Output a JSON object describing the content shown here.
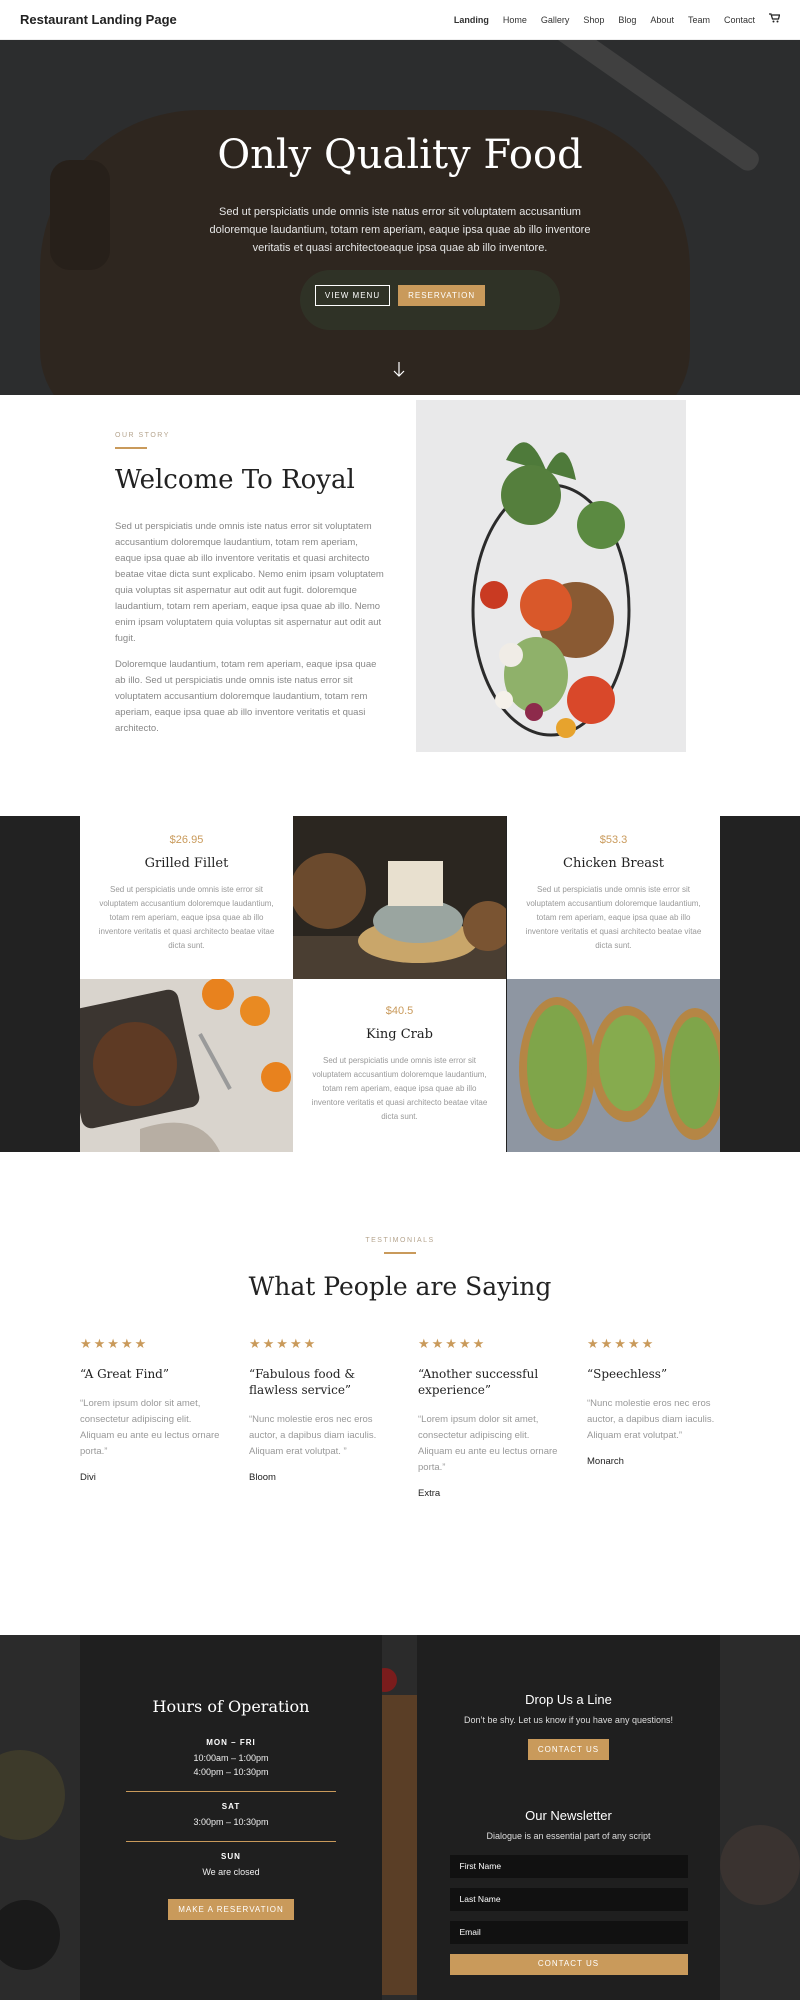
{
  "header": {
    "brand": "Restaurant Landing Page",
    "nav": [
      "Landing",
      "Home",
      "Gallery",
      "Shop",
      "Blog",
      "About",
      "Team",
      "Contact"
    ],
    "cart_icon": "cart-icon"
  },
  "hero": {
    "title": "Only Quality Food",
    "text": "Sed ut perspiciatis unde omnis iste natus error sit voluptatem accusantium doloremque laudantium, totam rem aperiam, eaque ipsa quae ab illo inventore veritatis et quasi architectoeaque ipsa quae ab illo inventore.",
    "btn_menu": "VIEW MENU",
    "btn_reservation": "RESERVATION",
    "arrow_icon": "arrow-down-icon"
  },
  "story": {
    "label": "OUR STORY",
    "title": "Welcome To Royal",
    "p1": "Sed ut perspiciatis unde omnis iste natus error sit voluptatem accusantium doloremque laudantium, totam rem aperiam, eaque ipsa quae ab illo inventore veritatis et quasi architecto beatae vitae dicta sunt explicabo. Nemo enim ipsam voluptatem quia voluptas sit aspernatur aut odit aut fugit. doloremque laudantium, totam rem aperiam, eaque ipsa quae ab illo. Nemo enim ipsam voluptatem quia voluptas sit aspernatur aut odit aut fugit.",
    "p2": "Doloremque laudantium, totam rem aperiam, eaque ipsa quae ab illo. Sed ut perspiciatis unde omnis iste natus error sit voluptatem accusantium doloremque laudantium, totam rem aperiam, eaque ipsa quae ab illo inventore veritatis et quasi architecto."
  },
  "menu": {
    "items": [
      {
        "price": "$26.95",
        "name": "Grilled Fillet",
        "desc": "Sed ut perspiciatis unde omnis iste error sit voluptatem accusantium doloremque laudantium, totam rem aperiam, eaque ipsa quae ab illo inventore veritatis et quasi architecto beatae vitae dicta sunt."
      },
      {
        "price": "$53.3",
        "name": "Chicken Breast",
        "desc": "Sed ut perspiciatis unde omnis iste error sit voluptatem accusantium doloremque laudantium, totam rem aperiam, eaque ipsa quae ab illo inventore veritatis et quasi architecto beatae vitae dicta sunt."
      },
      {
        "price": "$40.5",
        "name": "King Crab",
        "desc": "Sed ut perspiciatis unde omnis iste error sit voluptatem accusantium doloremque laudantium, totam rem aperiam, eaque ipsa quae ab illo inventore veritatis et quasi architecto beatae vitae dicta sunt."
      }
    ]
  },
  "testimonials": {
    "label": "TESTIMONIALS",
    "title": "What People are Saying",
    "stars": "★★★★★",
    "items": [
      {
        "head": "“A Great Find”",
        "body": "“Lorem ipsum dolor sit amet, consectetur adipiscing elit. Aliquam eu ante eu lectus ornare porta.”",
        "author": "Divi"
      },
      {
        "head": "“Fabulous food & flawless service”",
        "body": "“Nunc molestie eros nec eros auctor, a dapibus diam iaculis. Aliquam erat volutpat. ”",
        "author": "Bloom"
      },
      {
        "head": "“Another successful experience”",
        "body": "“Lorem ipsum dolor sit amet, consectetur adipiscing elit. Aliquam eu ante eu lectus ornare porta.”",
        "author": "Extra"
      },
      {
        "head": "“Speechless”",
        "body": "“Nunc molestie eros nec eros auctor, a dapibus diam iaculis. Aliquam erat volutpat.”",
        "author": "Monarch"
      }
    ]
  },
  "hours": {
    "title": "Hours of Operation",
    "mon_fri_label": "MON – FRI",
    "mon_fri_1": "10:00am – 1:00pm",
    "mon_fri_2": "4:00pm – 10:30pm",
    "sat_label": "SAT",
    "sat_time": "3:00pm – 10:30pm",
    "sun_label": "SUN",
    "sun_time": "We are closed",
    "button": "MAKE A RESERVATION"
  },
  "contact": {
    "drop_title": "Drop Us a Line",
    "drop_sub": "Don’t be shy. Let us know if you have any questions!",
    "drop_button": "CONTACT US",
    "newsletter_title": "Our Newsletter",
    "newsletter_sub": "Dialogue is an essential part of any script",
    "first_name": "First Name",
    "last_name": "Last Name",
    "email": "Email",
    "submit": "CONTACT US"
  },
  "colors": {
    "accent": "#c99a5b",
    "dark": "#1f1f1f"
  }
}
